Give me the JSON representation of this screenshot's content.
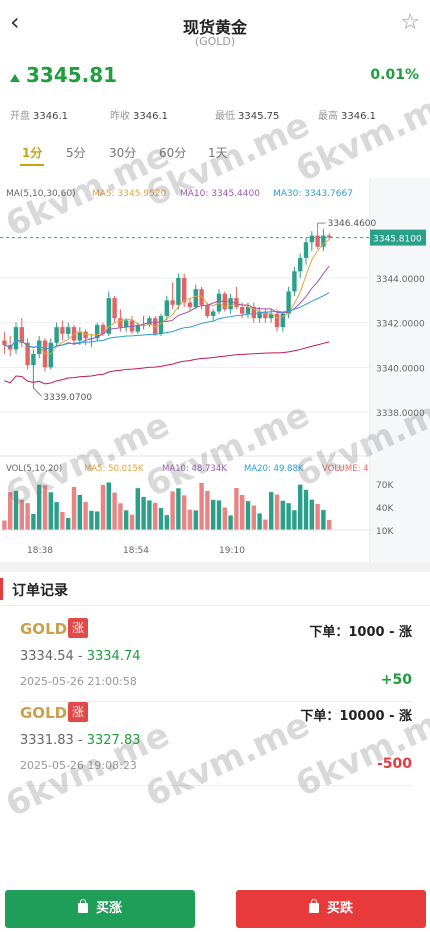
{
  "header": {
    "back_icon": "back-chevron-icon",
    "title": "现货黄金",
    "subtitle": "(GOLD)",
    "star_icon": "star-outline-icon"
  },
  "quote": {
    "price": "3345.81",
    "change_pct": "0.01%",
    "direction": "up",
    "color": "#1e9e3c"
  },
  "stats": [
    {
      "label": "开盘",
      "value": "3346.1"
    },
    {
      "label": "昨收",
      "value": "3346.1"
    },
    {
      "label": "最低",
      "value": "3345.75"
    },
    {
      "label": "最高",
      "value": "3346.1"
    }
  ],
  "timeframes": [
    "1分",
    "5分",
    "30分",
    "60分",
    "1天"
  ],
  "active_timeframe": "1分",
  "chart_data": {
    "type": "candlestick",
    "ma_legend": {
      "params": "MA(5,10,30,60)",
      "items": [
        {
          "name": "MA5: 3345.9520",
          "color": "#e8a33a"
        },
        {
          "name": "MA10: 3345.4400",
          "color": "#9b59b6"
        },
        {
          "name": "MA30: 3343.7667",
          "color": "#2a9fd6"
        }
      ]
    },
    "y_ticks": [
      "3344.0000",
      "3342.0000",
      "3340.0000",
      "3338.0000"
    ],
    "current_price_label": "3345.8100",
    "high_label": "3346.4600",
    "low_label": "3339.0700",
    "candles": [
      [
        3341.2,
        3341.6,
        3340.6,
        3341.0
      ],
      [
        3341.0,
        3341.4,
        3340.5,
        3340.8
      ],
      [
        3340.8,
        3342.0,
        3340.6,
        3341.8
      ],
      [
        3341.8,
        3342.2,
        3340.9,
        3341.1
      ],
      [
        3341.1,
        3341.3,
        3339.9,
        3340.1
      ],
      [
        3340.1,
        3340.8,
        3339.07,
        3340.6
      ],
      [
        3340.6,
        3341.4,
        3340.4,
        3341.2
      ],
      [
        3341.2,
        3341.3,
        3339.8,
        3340.0
      ],
      [
        3340.0,
        3341.3,
        3339.9,
        3341.1
      ],
      [
        3341.1,
        3342.0,
        3340.9,
        3341.8
      ],
      [
        3341.8,
        3342.1,
        3341.2,
        3341.5
      ],
      [
        3341.5,
        3342.0,
        3341.3,
        3341.8
      ],
      [
        3341.8,
        3341.9,
        3341.0,
        3341.2
      ],
      [
        3341.2,
        3341.8,
        3341.0,
        3341.6
      ],
      [
        3341.6,
        3341.7,
        3341.0,
        3341.3
      ],
      [
        3341.3,
        3341.5,
        3340.9,
        3341.3
      ],
      [
        3341.3,
        3342.0,
        3341.2,
        3341.9
      ],
      [
        3341.9,
        3342.0,
        3341.4,
        3341.5
      ],
      [
        3341.5,
        3343.4,
        3341.4,
        3343.1
      ],
      [
        3343.1,
        3343.2,
        3342.0,
        3342.2
      ],
      [
        3342.2,
        3342.6,
        3341.6,
        3341.8
      ],
      [
        3341.8,
        3342.2,
        3341.6,
        3342.1
      ],
      [
        3342.1,
        3342.3,
        3341.5,
        3341.6
      ],
      [
        3341.6,
        3342.0,
        3341.5,
        3341.9
      ],
      [
        3341.9,
        3342.3,
        3341.7,
        3341.9
      ],
      [
        3341.9,
        3342.3,
        3341.8,
        3342.2
      ],
      [
        3342.2,
        3342.3,
        3341.4,
        3341.5
      ],
      [
        3341.5,
        3342.4,
        3341.4,
        3342.3
      ],
      [
        3342.3,
        3343.2,
        3342.1,
        3343.0
      ],
      [
        3343.0,
        3343.8,
        3342.6,
        3342.8
      ],
      [
        3342.8,
        3344.2,
        3342.6,
        3344.0
      ],
      [
        3344.0,
        3344.2,
        3342.7,
        3342.9
      ],
      [
        3342.9,
        3343.1,
        3342.5,
        3342.7
      ],
      [
        3342.7,
        3343.7,
        3342.6,
        3343.5
      ],
      [
        3343.5,
        3343.6,
        3342.6,
        3342.8
      ],
      [
        3342.8,
        3342.9,
        3342.2,
        3342.3
      ],
      [
        3342.3,
        3342.6,
        3342.1,
        3342.5
      ],
      [
        3342.5,
        3343.5,
        3342.4,
        3343.3
      ],
      [
        3343.3,
        3343.4,
        3342.5,
        3342.6
      ],
      [
        3342.6,
        3343.3,
        3342.4,
        3343.1
      ],
      [
        3343.1,
        3343.6,
        3342.6,
        3342.7
      ],
      [
        3342.7,
        3342.9,
        3342.2,
        3342.4
      ],
      [
        3342.4,
        3342.9,
        3342.2,
        3342.7
      ],
      [
        3342.7,
        3342.9,
        3342.0,
        3342.2
      ],
      [
        3342.2,
        3342.7,
        3342.0,
        3342.5
      ],
      [
        3342.5,
        3342.6,
        3342.0,
        3342.2
      ],
      [
        3342.2,
        3342.6,
        3342.0,
        3342.4
      ],
      [
        3342.4,
        3342.6,
        3341.6,
        3341.8
      ],
      [
        3341.8,
        3342.5,
        3341.6,
        3342.4
      ],
      [
        3342.4,
        3343.6,
        3342.2,
        3343.4
      ],
      [
        3343.4,
        3344.5,
        3343.2,
        3344.3
      ],
      [
        3344.3,
        3345.1,
        3344.0,
        3344.9
      ],
      [
        3344.9,
        3345.8,
        3344.6,
        3345.6
      ],
      [
        3345.6,
        3346.1,
        3345.2,
        3345.9
      ],
      [
        3345.9,
        3346.46,
        3345.3,
        3345.4
      ],
      [
        3345.4,
        3346.2,
        3345.2,
        3345.9
      ],
      [
        3345.9,
        3346.0,
        3345.7,
        3345.81
      ]
    ],
    "vol_legend": {
      "params": "VOL(5,10,20)",
      "items": [
        {
          "name": "MA5: 50.015K",
          "color": "#e8a33a"
        },
        {
          "name": "MA10: 48.734K",
          "color": "#9b59b6"
        },
        {
          "name": "MA20: 49.88K",
          "color": "#2a9fd6"
        },
        {
          "name": "VOLUME: 4",
          "color": "#e86a6a"
        }
      ]
    },
    "vol_ticks": [
      "70K",
      "40K",
      "10K"
    ],
    "x_ticks": [
      "18:38",
      "18:54",
      "19:10"
    ]
  },
  "orders_section": {
    "title": "订单记录"
  },
  "orders": [
    {
      "symbol": "GOLD",
      "badge": "涨",
      "qty": "下单：1000 - 涨",
      "open": "3334.54",
      "sep": " - ",
      "close": "3334.74",
      "time": "2025-05-26 21:00:58",
      "pnl": "+50",
      "pnl_color": "#1e9e3c"
    },
    {
      "symbol": "GOLD",
      "badge": "涨",
      "qty": "下单：10000 - 涨",
      "open": "3331.83",
      "sep": " - ",
      "close": "3327.83",
      "time": "2025-05-26 19:08:23",
      "pnl": "-500",
      "pnl_color": "#e23c3c"
    }
  ],
  "buttons": {
    "buy": "买涨",
    "sell": "买跌",
    "bag_icon": "shopping-bag-icon"
  },
  "watermark": "6kvm.me"
}
